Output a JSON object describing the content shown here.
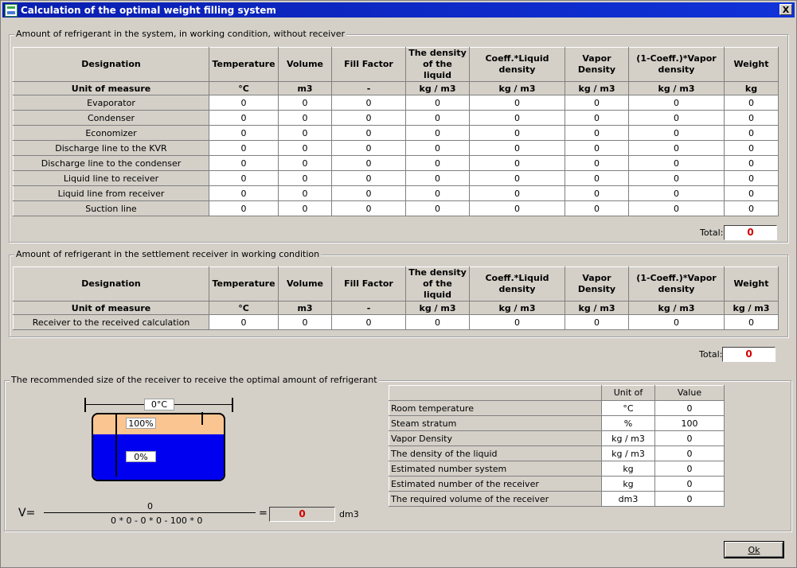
{
  "window": {
    "title": "Calculation of the optimal weight filling system",
    "close_label": "X"
  },
  "headers": {
    "designation": "Designation",
    "temperature": "Temperature",
    "volume": "Volume",
    "fill_factor": "Fill Factor",
    "liquid_density": "The density of the liquid",
    "coeff_liquid": "Coeff.*Liquid density",
    "vapor_density": "Vapor Density",
    "one_minus_coeff": "(1-Coeff.)*Vapor density",
    "weight": "Weight"
  },
  "section1": {
    "legend": "Amount of refrigerant in the system, in working condition, without receiver",
    "units": [
      "Unit of measure",
      "°C",
      "m3",
      "-",
      "kg / m3",
      "kg / m3",
      "kg / m3",
      "kg / m3",
      "kg"
    ],
    "rows": [
      {
        "name": "Evaporator",
        "values": [
          "0",
          "0",
          "0",
          "0",
          "0",
          "0",
          "0",
          "0"
        ]
      },
      {
        "name": "Condenser",
        "values": [
          "0",
          "0",
          "0",
          "0",
          "0",
          "0",
          "0",
          "0"
        ]
      },
      {
        "name": "Economizer",
        "values": [
          "0",
          "0",
          "0",
          "0",
          "0",
          "0",
          "0",
          "0"
        ]
      },
      {
        "name": "Discharge line to the KVR",
        "values": [
          "0",
          "0",
          "0",
          "0",
          "0",
          "0",
          "0",
          "0"
        ]
      },
      {
        "name": "Discharge line to the condenser",
        "values": [
          "0",
          "0",
          "0",
          "0",
          "0",
          "0",
          "0",
          "0"
        ]
      },
      {
        "name": "Liquid line to receiver",
        "values": [
          "0",
          "0",
          "0",
          "0",
          "0",
          "0",
          "0",
          "0"
        ]
      },
      {
        "name": "Liquid line from receiver",
        "values": [
          "0",
          "0",
          "0",
          "0",
          "0",
          "0",
          "0",
          "0"
        ]
      },
      {
        "name": "Suction line",
        "values": [
          "0",
          "0",
          "0",
          "0",
          "0",
          "0",
          "0",
          "0"
        ]
      }
    ],
    "total_label": "Total:",
    "total_value": "0"
  },
  "section2": {
    "legend": "Amount of refrigerant in the settlement receiver in working condition",
    "units": [
      "Unit of measure",
      "°C",
      "m3",
      "-",
      "kg / m3",
      "kg / m3",
      "kg / m3",
      "kg / m3",
      "kg / m3"
    ],
    "rows": [
      {
        "name": "Receiver to the received calculation",
        "values": [
          "0",
          "0",
          "0",
          "0",
          "0",
          "0",
          "0",
          "0"
        ]
      }
    ],
    "total_label": "Total:",
    "total_value": "0"
  },
  "section3": {
    "legend": "The recommended size of the receiver to receive the optimal amount of refrigerant",
    "drawing": {
      "temp_label": "0°C",
      "vapor_pct_label": "100%",
      "liquid_pct_label": "0%",
      "liquid_fill_fraction": 0.7
    },
    "formula": {
      "v_label": "V=",
      "numerator": "0",
      "denominator": "0 * 0 - 0 * 0 - 100 * 0",
      "equals": "=",
      "result": "0",
      "unit": "dm3"
    },
    "params": {
      "col_unit": "Unit of",
      "col_value": "Value",
      "rows": [
        {
          "name": "Room temperature",
          "unit": "°C",
          "value": "0"
        },
        {
          "name": "Steam stratum",
          "unit": "%",
          "value": "100"
        },
        {
          "name": "Vapor Density",
          "unit": "kg / m3",
          "value": "0"
        },
        {
          "name": "The density of the liquid",
          "unit": "kg / m3",
          "value": "0"
        },
        {
          "name": "Estimated number system",
          "unit": "kg",
          "value": "0"
        },
        {
          "name": "Estimated number of the receiver",
          "unit": "kg",
          "value": "0"
        },
        {
          "name": "The required volume of the receiver",
          "unit": "dm3",
          "value": "0"
        }
      ]
    }
  },
  "ok_button": "Ok",
  "colors": {
    "titlebar": "#0a24b7",
    "total_text": "#d00000",
    "vapor": "#fbc592",
    "liquid": "#0000f0"
  }
}
